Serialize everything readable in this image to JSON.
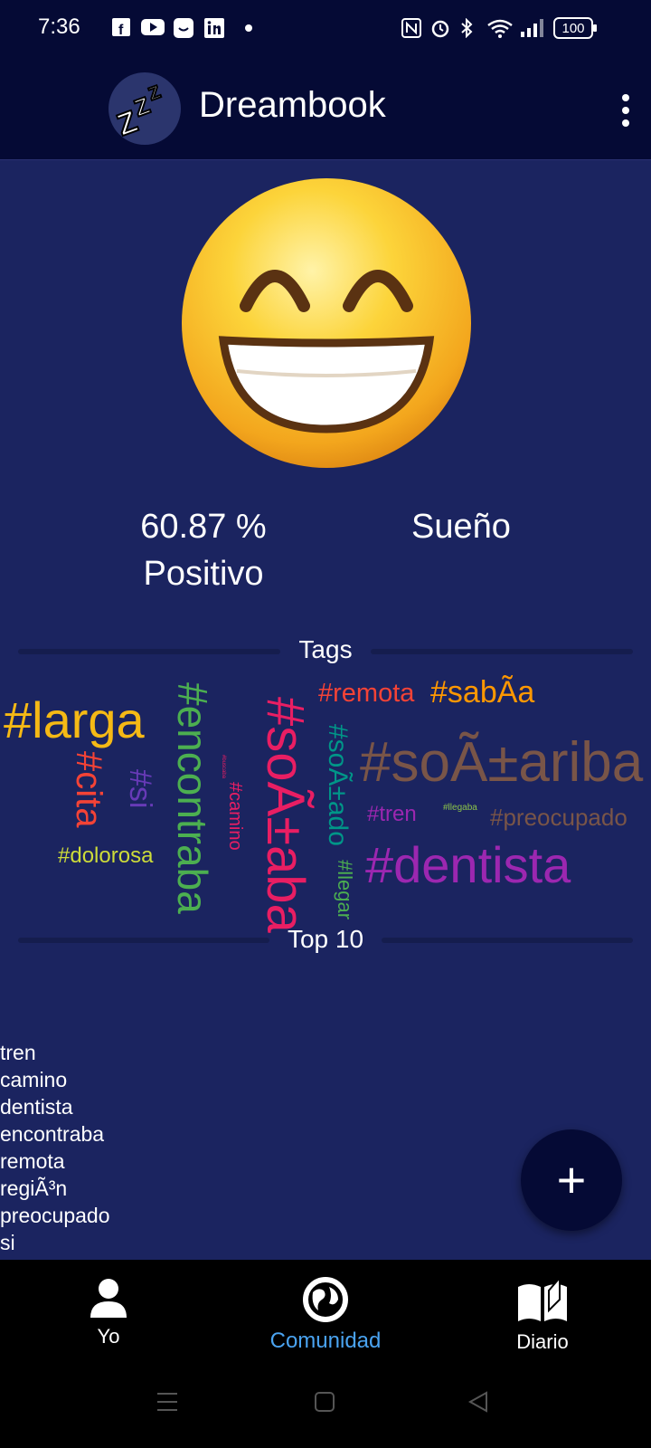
{
  "status_bar": {
    "time": "7:36",
    "battery": "100",
    "icons": [
      "facebook-icon",
      "youtube-icon",
      "message-icon",
      "linkedin-icon",
      "dot-icon",
      "nfc-icon",
      "alarm-icon",
      "bluetooth-icon",
      "wifi-icon",
      "signal-icon",
      "battery-icon"
    ]
  },
  "app_bar": {
    "title": "Dreambook",
    "logo_text": "ZZZ"
  },
  "summary": {
    "percent": "60.87 %",
    "sentiment": "Positivo",
    "category": "Sueño"
  },
  "tags_section": {
    "label": "Tags",
    "tags": [
      "#larga",
      "#encontraba",
      "#soÃ±aba",
      "#remota",
      "#sabÃa",
      "#soÃ±ariba",
      "#cita",
      "#si",
      "#dolorosa",
      "#camino",
      "#soÃ±ado",
      "#tren",
      "#llegaba",
      "#preocupado",
      "#dentista",
      "#llegar",
      "#buscaba"
    ]
  },
  "top10": {
    "label": "Top 10",
    "items": [
      "tren",
      "camino",
      "dentista",
      "encontraba",
      "remota",
      "regiÃ³n",
      "preocupado",
      "si"
    ]
  },
  "fab": {
    "label": "+"
  },
  "bottom_nav": {
    "items": [
      {
        "label": "Yo",
        "icon": "person-icon"
      },
      {
        "label": "Comunidad",
        "icon": "globe-icon"
      },
      {
        "label": "Diario",
        "icon": "book-icon"
      }
    ],
    "active_color": "#4aa3f0"
  },
  "colors": {
    "background": "#1b2460",
    "app_bar": "#050a35"
  }
}
